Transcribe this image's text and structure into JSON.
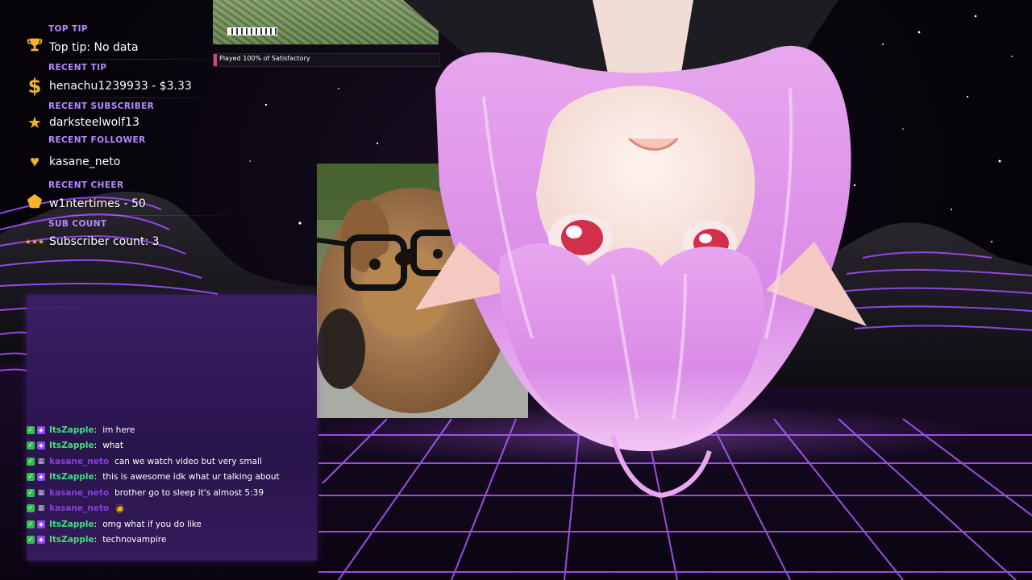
{
  "info_panel": {
    "top_tip": {
      "heading": "TOP TIP",
      "value": "Top tip: No data",
      "icon": "trophy-icon"
    },
    "recent_tip": {
      "heading": "RECENT TIP",
      "value": "henachu1239933 - $3.33",
      "icon": "dollar-icon"
    },
    "recent_subscriber": {
      "heading": "RECENT SUBSCRIBER",
      "value": "darksteelwolf13",
      "icon": "star-icon"
    },
    "recent_follower": {
      "heading": "RECENT FOLLOWER",
      "value": "kasane_neto",
      "icon": "heart-icon"
    },
    "recent_cheer": {
      "heading": "RECENT CHEER",
      "value": "w1ntertimes - 50",
      "icon": "pentagon-gem-icon"
    },
    "sub_count": {
      "heading": "SUB COUNT",
      "value": "Subscriber count: 3",
      "icon": "stars-icon"
    }
  },
  "game_widget": {
    "progress_label": "Played 100% of Satisfactory",
    "progress_value": 1.0
  },
  "chat": {
    "messages": [
      {
        "user": "ItsZapple",
        "message": "im here",
        "user_color": "#3ee07a",
        "badge2": "sub"
      },
      {
        "user": "ItsZapple",
        "message": "what",
        "user_color": "#3ee07a",
        "badge2": "sub"
      },
      {
        "user": "kasane_neto",
        "message": "can we watch video but very small",
        "user_color": "#8a3fe0",
        "badge2": "gray"
      },
      {
        "user": "ItsZapple",
        "message": "this is awesome idk what ur talking about",
        "user_color": "#3ee07a",
        "badge2": "sub"
      },
      {
        "user": "kasane_neto",
        "message": "brother go to sleep it's almost 5:39",
        "user_color": "#8a3fe0",
        "badge2": "gray"
      },
      {
        "user": "kasane_neto",
        "message": "🧔",
        "user_color": "#8a3fe0",
        "badge2": "gray"
      },
      {
        "user": "ItsZapple",
        "message": "omg what if you do like",
        "user_color": "#3ee07a",
        "badge2": "sub"
      },
      {
        "user": "ItsZapple",
        "message": "technovampire",
        "user_color": "#3ee07a",
        "badge2": "sub"
      }
    ]
  },
  "colors": {
    "accent_purple": "#b58bff",
    "icon_gold": "#f2b42a",
    "grid_purple": "#a24dff",
    "chat_bg": "#3e206c"
  }
}
